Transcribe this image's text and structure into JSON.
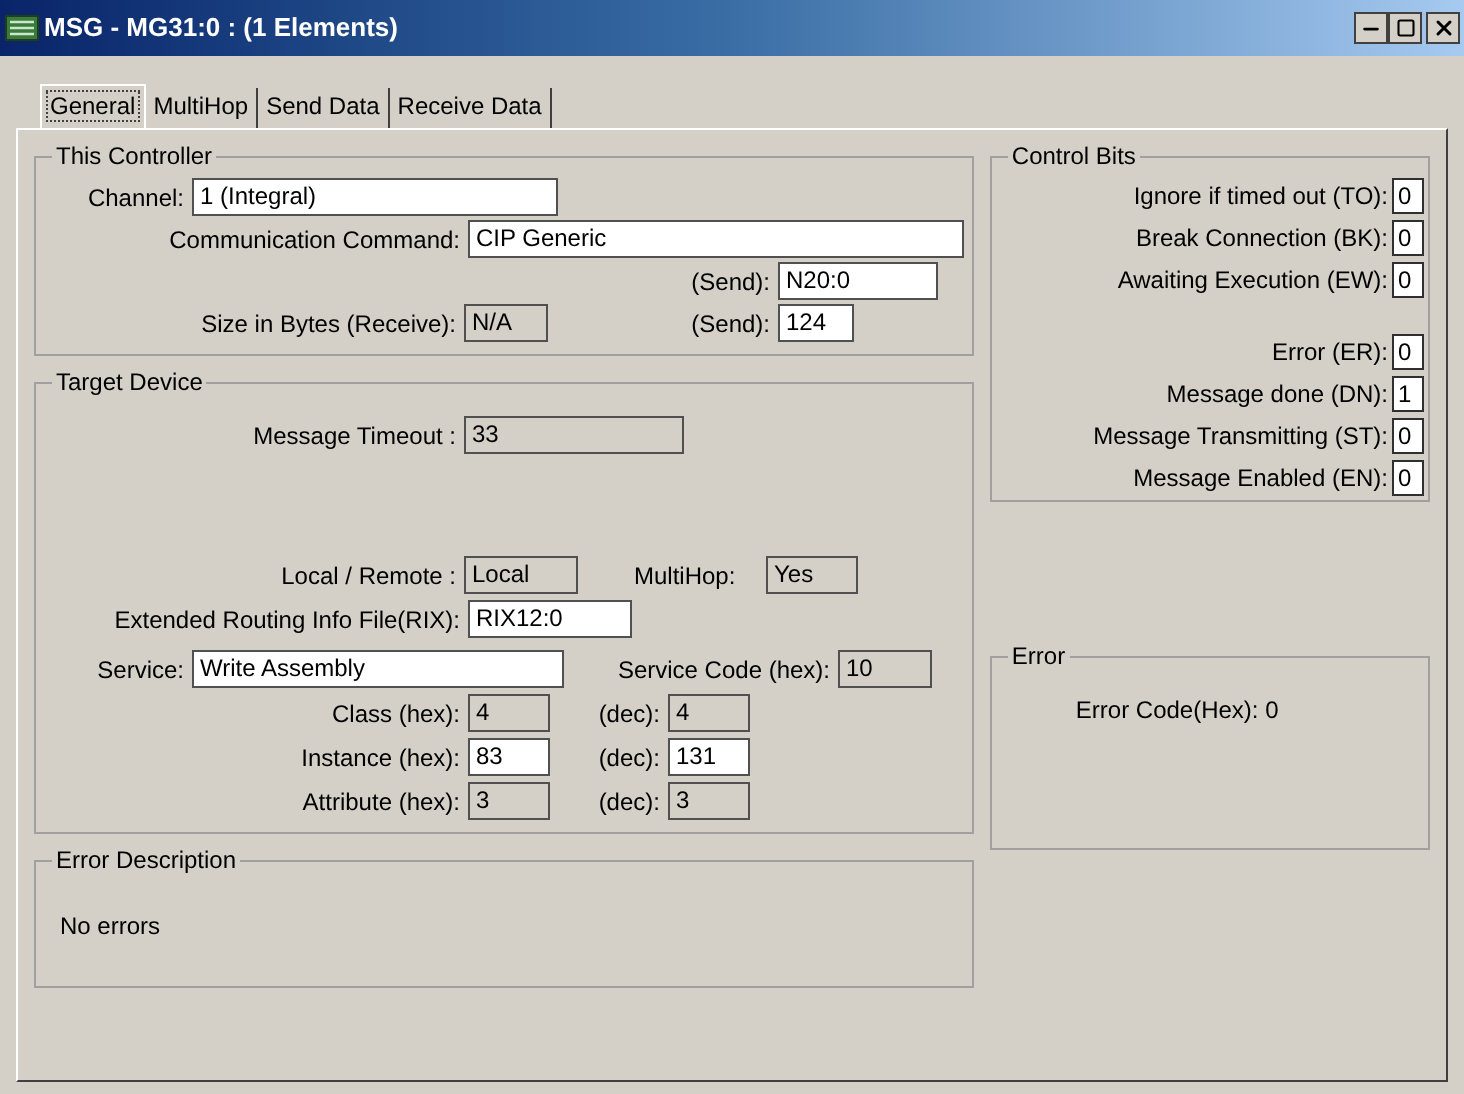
{
  "window": {
    "title": "MSG - MG31:0 : (1 Elements)"
  },
  "tabs": [
    {
      "label": "General",
      "selected": true
    },
    {
      "label": "MultiHop",
      "selected": false
    },
    {
      "label": "Send Data",
      "selected": false
    },
    {
      "label": "Receive Data",
      "selected": false
    }
  ],
  "this_controller": {
    "title": "This Controller",
    "channel": {
      "label": "Channel:",
      "value": "1 (Integral)",
      "readonly": false
    },
    "command": {
      "label": "Communication Command:",
      "value": "CIP Generic",
      "readonly": false
    },
    "send_file": {
      "label": "(Send):",
      "value": "N20:0",
      "readonly": false
    },
    "size_receive": {
      "label": "Size in Bytes (Receive):",
      "value": "N/A",
      "readonly": true
    },
    "size_send": {
      "label": "(Send):",
      "value": "124",
      "readonly": false
    }
  },
  "target_device": {
    "title": "Target Device",
    "message_timeout": {
      "label": "Message Timeout :",
      "value": "33",
      "readonly": true
    },
    "local_remote": {
      "label": "Local / Remote :",
      "value": "Local",
      "readonly": true
    },
    "multihop": {
      "label": "MultiHop:",
      "value": "Yes",
      "readonly": true
    },
    "routing_file": {
      "label": "Extended Routing Info File(RIX):",
      "value": "RIX12:0",
      "readonly": false
    },
    "service": {
      "label": "Service:",
      "value": "Write Assembly",
      "readonly": false
    },
    "service_code": {
      "label": "Service Code (hex):",
      "value": "10",
      "readonly": true
    },
    "params": [
      {
        "label": "Class (hex):",
        "hex": {
          "value": "4",
          "readonly": true
        },
        "dec_label": "(dec):",
        "dec": {
          "value": "4",
          "readonly": true
        }
      },
      {
        "label": "Instance (hex):",
        "hex": {
          "value": "83",
          "readonly": false
        },
        "dec_label": "(dec):",
        "dec": {
          "value": "131",
          "readonly": false
        }
      },
      {
        "label": "Attribute (hex):",
        "hex": {
          "value": "3",
          "readonly": true
        },
        "dec_label": "(dec):",
        "dec": {
          "value": "3",
          "readonly": true
        }
      }
    ]
  },
  "error_description": {
    "title": "Error Description",
    "text": "No errors"
  },
  "control_bits": {
    "title": "Control Bits",
    "groups": [
      {
        "bits": [
          {
            "label": "Ignore if timed out (TO):",
            "value": "0"
          },
          {
            "label": "Break Connection (BK):",
            "value": "0"
          },
          {
            "label": "Awaiting Execution (EW):",
            "value": "0"
          }
        ]
      },
      {
        "bits": [
          {
            "label": "Error (ER):",
            "value": "0"
          },
          {
            "label": "Message done (DN):",
            "value": "1"
          },
          {
            "label": "Message Transmitting (ST):",
            "value": "0"
          },
          {
            "label": "Message Enabled (EN):",
            "value": "0"
          }
        ]
      }
    ]
  },
  "error": {
    "title": "Error",
    "text": "Error Code(Hex): 0"
  }
}
